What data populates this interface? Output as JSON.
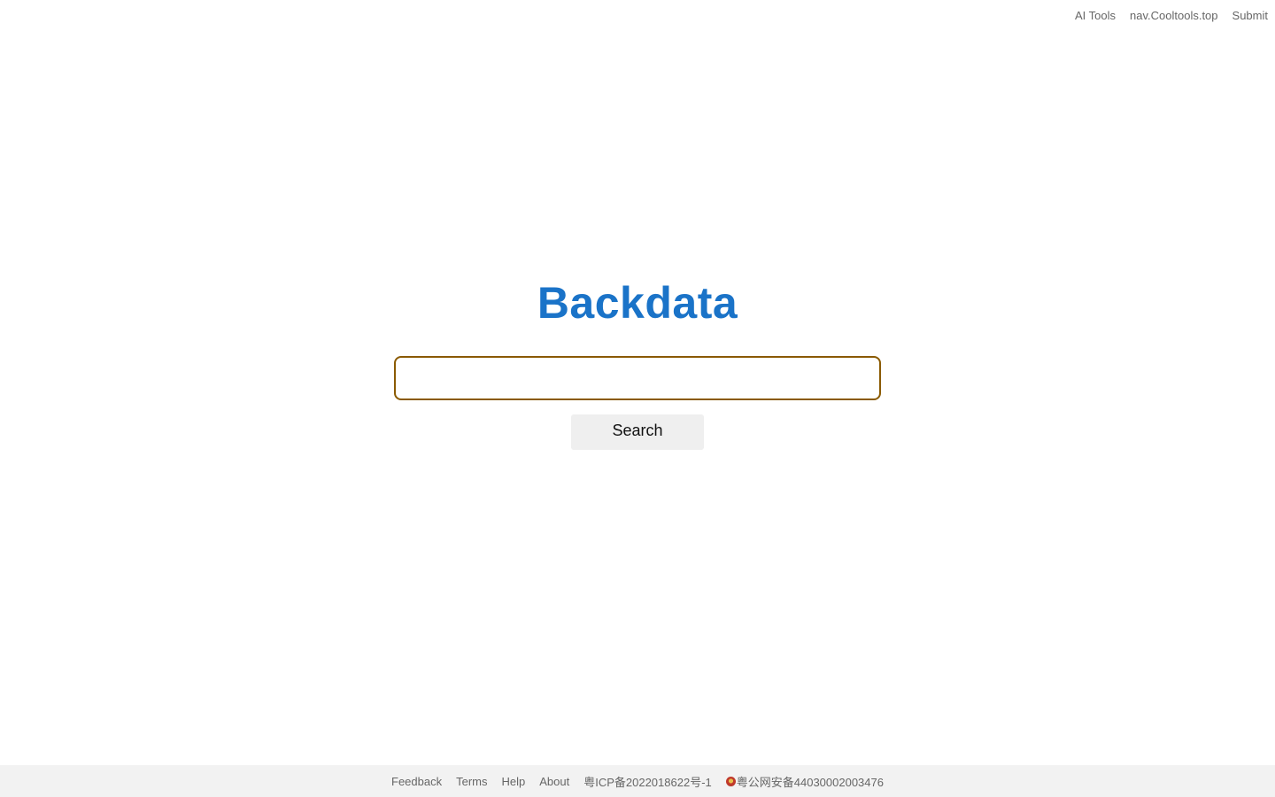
{
  "top_nav": {
    "items": [
      {
        "label": "AI Tools"
      },
      {
        "label": "nav.Cooltools.top"
      },
      {
        "label": "Submit"
      }
    ]
  },
  "logo": {
    "text": "Backdata",
    "color": "#1a73c8"
  },
  "search": {
    "value": "",
    "placeholder": "",
    "button_label": "Search",
    "border_color": "#8a5a00"
  },
  "footer": {
    "links": [
      {
        "label": "Feedback"
      },
      {
        "label": "Terms"
      },
      {
        "label": "Help"
      },
      {
        "label": "About"
      },
      {
        "label": "粤ICP备2022018622号-1"
      }
    ],
    "police_record": {
      "icon": "police-badge-icon",
      "label": "粤公网安备44030002003476"
    }
  }
}
